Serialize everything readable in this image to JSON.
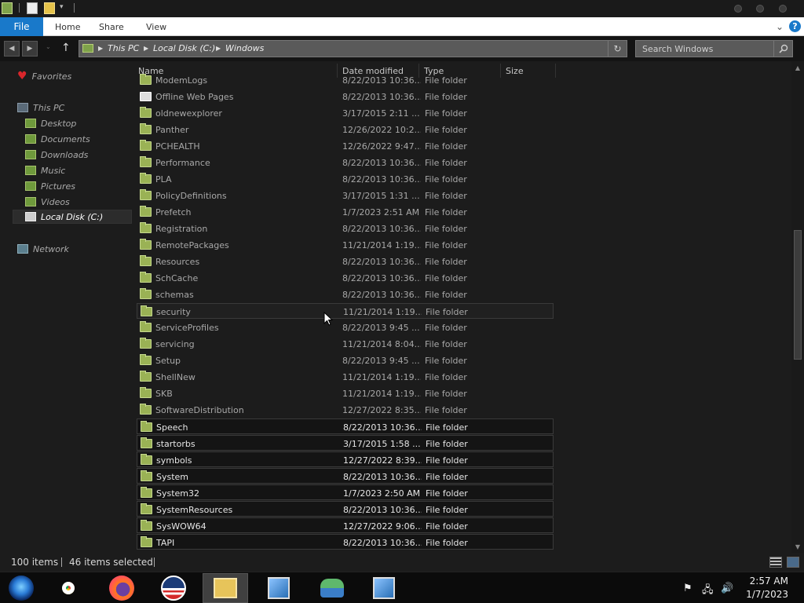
{
  "titlebar": {
    "quick_access": [
      "folder-icon",
      "properties-icon",
      "new-folder-icon",
      "customize-dropdown-icon"
    ]
  },
  "ribbon": {
    "tabs": [
      {
        "label": "File"
      },
      {
        "label": "Home"
      },
      {
        "label": "Share"
      },
      {
        "label": "View"
      }
    ],
    "help": "?"
  },
  "address": {
    "crumbs": [
      "This PC",
      "Local Disk (C:)",
      "Windows"
    ]
  },
  "search": {
    "placeholder": "Search Windows"
  },
  "navpane": {
    "favorites": "Favorites",
    "this_pc": "This PC",
    "items": [
      {
        "label": "Desktop"
      },
      {
        "label": "Documents"
      },
      {
        "label": "Downloads"
      },
      {
        "label": "Music"
      },
      {
        "label": "Pictures"
      },
      {
        "label": "Videos"
      },
      {
        "label": "Local Disk (C:)"
      }
    ],
    "network": "Network"
  },
  "columns": {
    "name": "Name",
    "date": "Date modified",
    "type": "Type",
    "size": "Size"
  },
  "files": [
    {
      "name": "ModemLogs",
      "date": "8/22/2013 10:36...",
      "type": "File folder",
      "selected": false
    },
    {
      "name": "Offline Web Pages",
      "date": "8/22/2013 10:36...",
      "type": "File folder",
      "selected": false,
      "icon": "web"
    },
    {
      "name": "oldnewexplorer",
      "date": "3/17/2015 2:11 ...",
      "type": "File folder",
      "selected": false
    },
    {
      "name": "Panther",
      "date": "12/26/2022 10:2...",
      "type": "File folder",
      "selected": false
    },
    {
      "name": "PCHEALTH",
      "date": "12/26/2022 9:47...",
      "type": "File folder",
      "selected": false
    },
    {
      "name": "Performance",
      "date": "8/22/2013 10:36...",
      "type": "File folder",
      "selected": false
    },
    {
      "name": "PLA",
      "date": "8/22/2013 10:36...",
      "type": "File folder",
      "selected": false
    },
    {
      "name": "PolicyDefinitions",
      "date": "3/17/2015 1:31 ...",
      "type": "File folder",
      "selected": false
    },
    {
      "name": "Prefetch",
      "date": "1/7/2023 2:51 AM",
      "type": "File folder",
      "selected": false
    },
    {
      "name": "Registration",
      "date": "8/22/2013 10:36...",
      "type": "File folder",
      "selected": false
    },
    {
      "name": "RemotePackages",
      "date": "11/21/2014 1:19...",
      "type": "File folder",
      "selected": false
    },
    {
      "name": "Resources",
      "date": "8/22/2013 10:36...",
      "type": "File folder",
      "selected": false
    },
    {
      "name": "SchCache",
      "date": "8/22/2013 10:36...",
      "type": "File folder",
      "selected": false
    },
    {
      "name": "schemas",
      "date": "8/22/2013 10:36...",
      "type": "File folder",
      "selected": false
    },
    {
      "name": "security",
      "date": "11/21/2014 1:19...",
      "type": "File folder",
      "selected": false,
      "hovered": true
    },
    {
      "name": "ServiceProfiles",
      "date": "8/22/2013 9:45 ...",
      "type": "File folder",
      "selected": false
    },
    {
      "name": "servicing",
      "date": "11/21/2014 8:04...",
      "type": "File folder",
      "selected": false
    },
    {
      "name": "Setup",
      "date": "8/22/2013 9:45 ...",
      "type": "File folder",
      "selected": false
    },
    {
      "name": "ShellNew",
      "date": "11/21/2014 1:19...",
      "type": "File folder",
      "selected": false
    },
    {
      "name": "SKB",
      "date": "11/21/2014 1:19...",
      "type": "File folder",
      "selected": false
    },
    {
      "name": "SoftwareDistribution",
      "date": "12/27/2022 8:35...",
      "type": "File folder",
      "selected": false
    },
    {
      "name": "Speech",
      "date": "8/22/2013 10:36...",
      "type": "File folder",
      "selected": true
    },
    {
      "name": "startorbs",
      "date": "3/17/2015 1:58 ...",
      "type": "File folder",
      "selected": true
    },
    {
      "name": "symbols",
      "date": "12/27/2022 8:39...",
      "type": "File folder",
      "selected": true
    },
    {
      "name": "System",
      "date": "8/22/2013 10:36...",
      "type": "File folder",
      "selected": true
    },
    {
      "name": "System32",
      "date": "1/7/2023 2:50 AM",
      "type": "File folder",
      "selected": true
    },
    {
      "name": "SystemResources",
      "date": "8/22/2013 10:36...",
      "type": "File folder",
      "selected": true
    },
    {
      "name": "SysWOW64",
      "date": "12/27/2022 9:06...",
      "type": "File folder",
      "selected": true
    },
    {
      "name": "TAPI",
      "date": "8/22/2013 10:36...",
      "type": "File folder",
      "selected": true
    }
  ],
  "status": {
    "items": "100 items",
    "selected": "46 items selected"
  },
  "taskbar": {
    "apps": [
      "start-orb-icon",
      "chrome-icon",
      "firefox-icon",
      "obama-logo-icon",
      "file-explorer-icon",
      "setup-installer-icon",
      "network-people-icon",
      "setup-installer-icon"
    ],
    "clock_time": "2:57 AM",
    "clock_date": "1/7/2023"
  },
  "colors": {
    "accent": "#1979ca",
    "folder": "#9ab255",
    "background": "#1c1c1c"
  }
}
